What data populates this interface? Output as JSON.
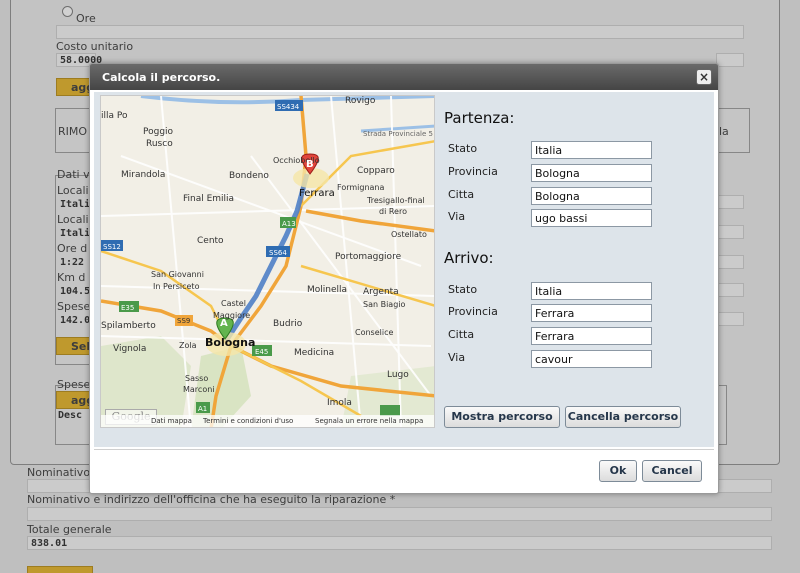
{
  "background": {
    "radio_label": "Ore",
    "costo_unitario_label": "Costo unitario",
    "costo_unitario_value": "58.0000",
    "btn_left_text": "agg",
    "rimo_text": "RIMO",
    "right_cut_text": "la",
    "dati_label": "Dati v",
    "locali_1_label": "Locali",
    "locali_1_value": "Italia",
    "locali_2_label": "Locali",
    "locali_2_value": "Italia",
    "ore_label": "Ore d",
    "ore_value": "1:22",
    "km_label": "Km d",
    "km_value": "104.5",
    "spese_label": "Spese",
    "spese_value": "142.0",
    "sel_text": "Sel",
    "spese2_label": "Spese",
    "agg2_text": "agg",
    "desc_text": "Desc",
    "nominativo_label": "Nominativo",
    "nominativo_officina_label": "Nominativo e indirizzo dell'officina che ha eseguito la riparazione *",
    "totale_label": "Totale generale",
    "totale_value": "838.01"
  },
  "dialog": {
    "title": "Calcola il percorso.",
    "close_symbol": "×",
    "partenza": {
      "heading": "Partenza:",
      "stato_label": "Stato",
      "stato_value": "Italia",
      "provincia_label": "Provincia",
      "provincia_value": "Bologna",
      "citta_label": "Citta",
      "citta_value": "Bologna",
      "via_label": "Via",
      "via_value": "ugo bassi"
    },
    "arrivo": {
      "heading": "Arrivo:",
      "stato_label": "Stato",
      "stato_value": "Italia",
      "provincia_label": "Provincia",
      "provincia_value": "Ferrara",
      "citta_label": "Citta",
      "citta_value": "Ferrara",
      "via_label": "Via",
      "via_value": "cavour"
    },
    "mostra_button": "Mostra percorso",
    "cancella_button": "Cancella percorso",
    "ok_button": "Ok",
    "cancel_button": "Cancel"
  },
  "map": {
    "marker_a": "A",
    "marker_b": "B",
    "google": "Google",
    "footer_dati": "Dati mappa",
    "footer_termini": "Termini e condizioni d'uso",
    "footer_segnala": "Segnala un errore nella mappa",
    "places": {
      "rovigo": "Rovigo",
      "ss434": "SS434",
      "villa_po": "illa Po",
      "poggio": "Poggio",
      "rusco": "Rusco",
      "provinciale": "Strada Provinciale 5",
      "occhiobello": "Occhiobello",
      "ferrara": "Ferrara",
      "copparo": "Copparo",
      "mirandola": "Mirandola",
      "bondeno": "Bondeno",
      "final": "Final Emilia",
      "formignana": "Formignana",
      "tresigallo": "Tresigallo-final",
      "di_rero": "di Rero",
      "a13": "A13",
      "ostellato": "Ostellato",
      "cento": "Cento",
      "ss12": "SS12",
      "ss64": "SS64",
      "portomaggiore": "Portomaggiore",
      "sgiovanni": "San Giovanni",
      "persiceto": "In Persiceto",
      "molinella": "Molinella",
      "argenta": "Argenta",
      "san_biagio": "San Biagio",
      "castel": "Castel",
      "maggiore": "Maggiore",
      "spilamberto": "Spilamberto",
      "budrio": "Budrio",
      "e35": "E35",
      "e45": "E45",
      "ss9": "SS9",
      "conselice": "Conselice",
      "vignola": "Vignola",
      "zola": "Zola",
      "bologna": "Bologna",
      "medicina": "Medicina",
      "sasso": "Sasso",
      "marconi": "Marconi",
      "lugo": "Lugo",
      "imola": "Imola",
      "a1": "A1"
    }
  }
}
